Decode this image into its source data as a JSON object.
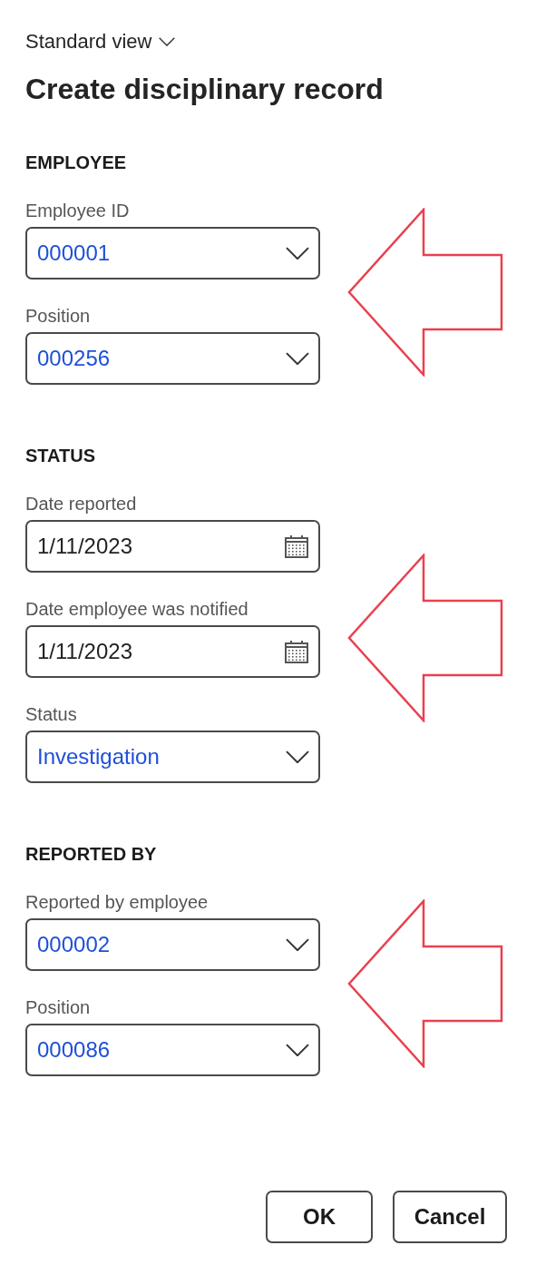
{
  "view_selector": {
    "label": "Standard view"
  },
  "title": "Create disciplinary record",
  "sections": [
    {
      "heading": "EMPLOYEE",
      "callout": true,
      "fields": [
        {
          "kind": "lookup",
          "label": "Employee ID",
          "value": "000001"
        },
        {
          "kind": "lookup",
          "label": "Position",
          "value": "000256"
        }
      ]
    },
    {
      "heading": "STATUS",
      "callout": true,
      "fields": [
        {
          "kind": "date",
          "label": "Date reported",
          "value": "1/11/2023"
        },
        {
          "kind": "date",
          "label": "Date employee was notified",
          "value": "1/11/2023"
        },
        {
          "kind": "lookup",
          "label": "Status",
          "value": "Investigation"
        }
      ]
    },
    {
      "heading": "REPORTED BY",
      "callout": true,
      "fields": [
        {
          "kind": "lookup",
          "label": "Reported by employee",
          "value": "000002"
        },
        {
          "kind": "lookup",
          "label": "Position",
          "value": "000086"
        }
      ]
    }
  ],
  "buttons": [
    {
      "label": "OK",
      "kind": "primary"
    },
    {
      "label": "Cancel",
      "kind": "secondary"
    }
  ]
}
